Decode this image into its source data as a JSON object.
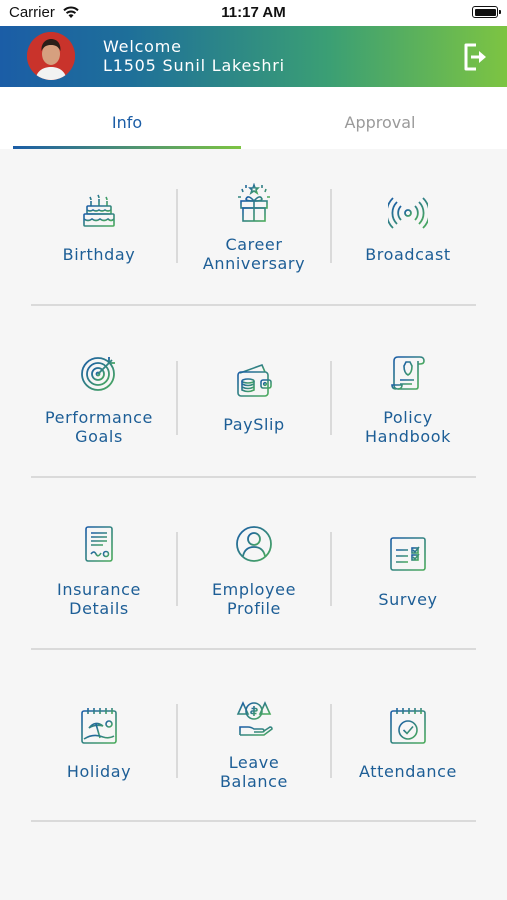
{
  "status_bar": {
    "carrier": "Carrier",
    "time": "11:17 AM"
  },
  "header": {
    "welcome": "Welcome",
    "user": "L1505 Sunil Lakeshri"
  },
  "tabs": [
    {
      "label": "Info"
    },
    {
      "label": "Approval"
    }
  ],
  "grid": [
    {
      "line1": "Birthday",
      "line2": "",
      "icon": "birthday-cake-icon"
    },
    {
      "line1": "Career",
      "line2": "Anniversary",
      "icon": "gift-box-icon"
    },
    {
      "line1": "Broadcast",
      "line2": "",
      "icon": "broadcast-icon"
    },
    {
      "line1": "Performance",
      "line2": "Goals",
      "icon": "target-icon"
    },
    {
      "line1": "PaySlip",
      "line2": "",
      "icon": "wallet-icon"
    },
    {
      "line1": "Policy",
      "line2": "Handbook",
      "icon": "scroll-icon"
    },
    {
      "line1": "Insurance",
      "line2": "Details",
      "icon": "document-icon"
    },
    {
      "line1": "Employee",
      "line2": "Profile",
      "icon": "user-profile-icon"
    },
    {
      "line1": "Survey",
      "line2": "",
      "icon": "checklist-icon"
    },
    {
      "line1": "Holiday",
      "line2": "",
      "icon": "beach-calendar-icon"
    },
    {
      "line1": "Leave",
      "line2": "Balance",
      "icon": "balance-scale-icon"
    },
    {
      "line1": "Attendance",
      "line2": "",
      "icon": "calendar-check-icon"
    }
  ],
  "colors": {
    "brand_blue": "#1b5da6",
    "brand_green": "#7dc442",
    "label_color": "#1d5e96"
  }
}
